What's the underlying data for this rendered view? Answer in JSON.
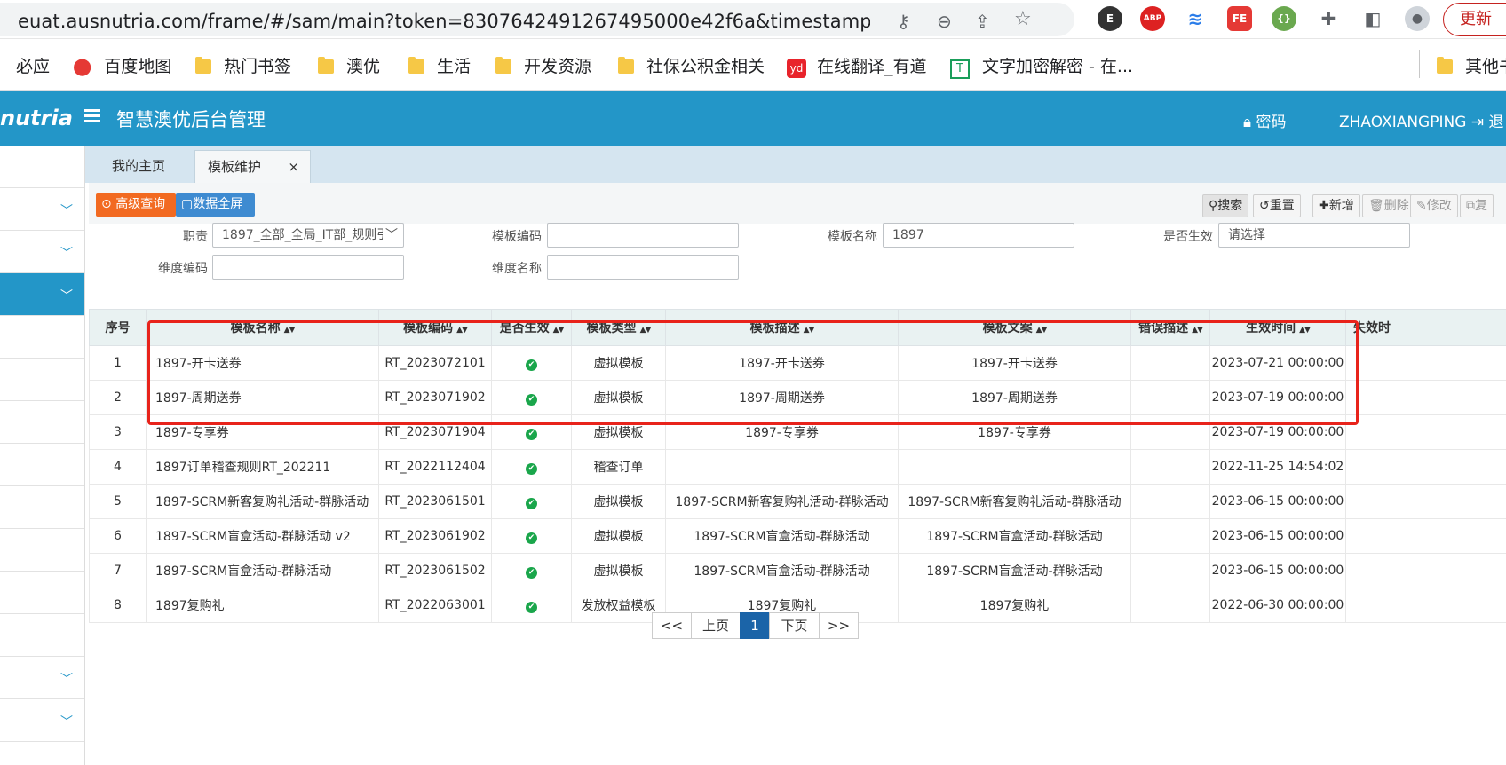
{
  "browser": {
    "url": "euat.ausnutria.com/frame/#/sam/main?token=8307642491267495000e42f6a&timestamp...",
    "update_label": "更新",
    "bookmarks": [
      "必应",
      "百度地图",
      "热门书签",
      "澳优",
      "生活",
      "开发资源",
      "社保公积金相关",
      "在线翻译_有道",
      "文字加密解密 - 在...",
      "其他书签"
    ]
  },
  "header": {
    "logo": "nutria",
    "title": "智慧澳优后台管理",
    "password_label": "密码",
    "username": "ZHAOXIANGPING",
    "logout_label": "退"
  },
  "tabs": [
    {
      "label": "我的主页"
    },
    {
      "label": "模板维护",
      "close": "×"
    }
  ],
  "toolbar": {
    "advanced_query": "高级查询",
    "fullscreen": "数据全屏",
    "search": "搜索",
    "reset": "重置",
    "add": "新增",
    "delete": "删除",
    "edit": "修改",
    "copy": "复"
  },
  "filters": {
    "duty_label": "职责",
    "duty_value": "1897_全部_全局_IT部_规则引",
    "template_code_label": "模板编码",
    "template_code_value": "",
    "template_name_label": "模板名称",
    "template_name_value": "1897",
    "effective_label": "是否生效",
    "effective_value": "请选择",
    "dim_code_label": "维度编码",
    "dim_code_value": "",
    "dim_name_label": "维度名称",
    "dim_name_value": ""
  },
  "table": {
    "columns": [
      "序号",
      "模板名称",
      "模板编码",
      "是否生效",
      "模板类型",
      "模板描述",
      "模板文案",
      "错误描述",
      "生效时间",
      "失效时"
    ],
    "rows": [
      [
        "1",
        "1897-开卡送券",
        "RT_2023072101",
        "✔",
        "虚拟模板",
        "1897-开卡送券",
        "1897-开卡送券",
        "",
        "2023-07-21 00:00:00",
        ""
      ],
      [
        "2",
        "1897-周期送券",
        "RT_2023071902",
        "✔",
        "虚拟模板",
        "1897-周期送券",
        "1897-周期送券",
        "",
        "2023-07-19 00:00:00",
        ""
      ],
      [
        "3",
        "1897-专享券",
        "RT_2023071904",
        "✔",
        "虚拟模板",
        "1897-专享券",
        "1897-专享券",
        "",
        "2023-07-19 00:00:00",
        ""
      ],
      [
        "4",
        "1897订单稽查规则RT_202211",
        "RT_2022112404",
        "✔",
        "稽查订单",
        "",
        "",
        "",
        "2022-11-25 14:54:02",
        ""
      ],
      [
        "5",
        "1897-SCRM新客复购礼活动-群脉活动",
        "RT_2023061501",
        "✔",
        "虚拟模板",
        "1897-SCRM新客复购礼活动-群脉活动",
        "1897-SCRM新客复购礼活动-群脉活动",
        "",
        "2023-06-15 00:00:00",
        ""
      ],
      [
        "6",
        "1897-SCRM盲盒活动-群脉活动 v2",
        "RT_2023061902",
        "✔",
        "虚拟模板",
        "1897-SCRM盲盒活动-群脉活动",
        "1897-SCRM盲盒活动-群脉活动",
        "",
        "2023-06-15 00:00:00",
        ""
      ],
      [
        "7",
        "1897-SCRM盲盒活动-群脉活动",
        "RT_2023061502",
        "✔",
        "虚拟模板",
        "1897-SCRM盲盒活动-群脉活动",
        "1897-SCRM盲盒活动-群脉活动",
        "",
        "2023-06-15 00:00:00",
        ""
      ],
      [
        "8",
        "1897复购礼",
        "RT_2022063001",
        "✔",
        "发放权益模板",
        "1897复购礼",
        "1897复购礼",
        "",
        "2022-06-30 00:00:00",
        ""
      ]
    ]
  },
  "pagination": {
    "first": "<<",
    "prev": "上页",
    "current": "1",
    "next": "下页",
    "last": ">>"
  },
  "colors": {
    "header_bg": "#2396c8",
    "highlight": "#e8231b",
    "orange_btn": "#f26a21",
    "blue_btn": "#3e8bd1",
    "ok": "#1aa64b"
  }
}
